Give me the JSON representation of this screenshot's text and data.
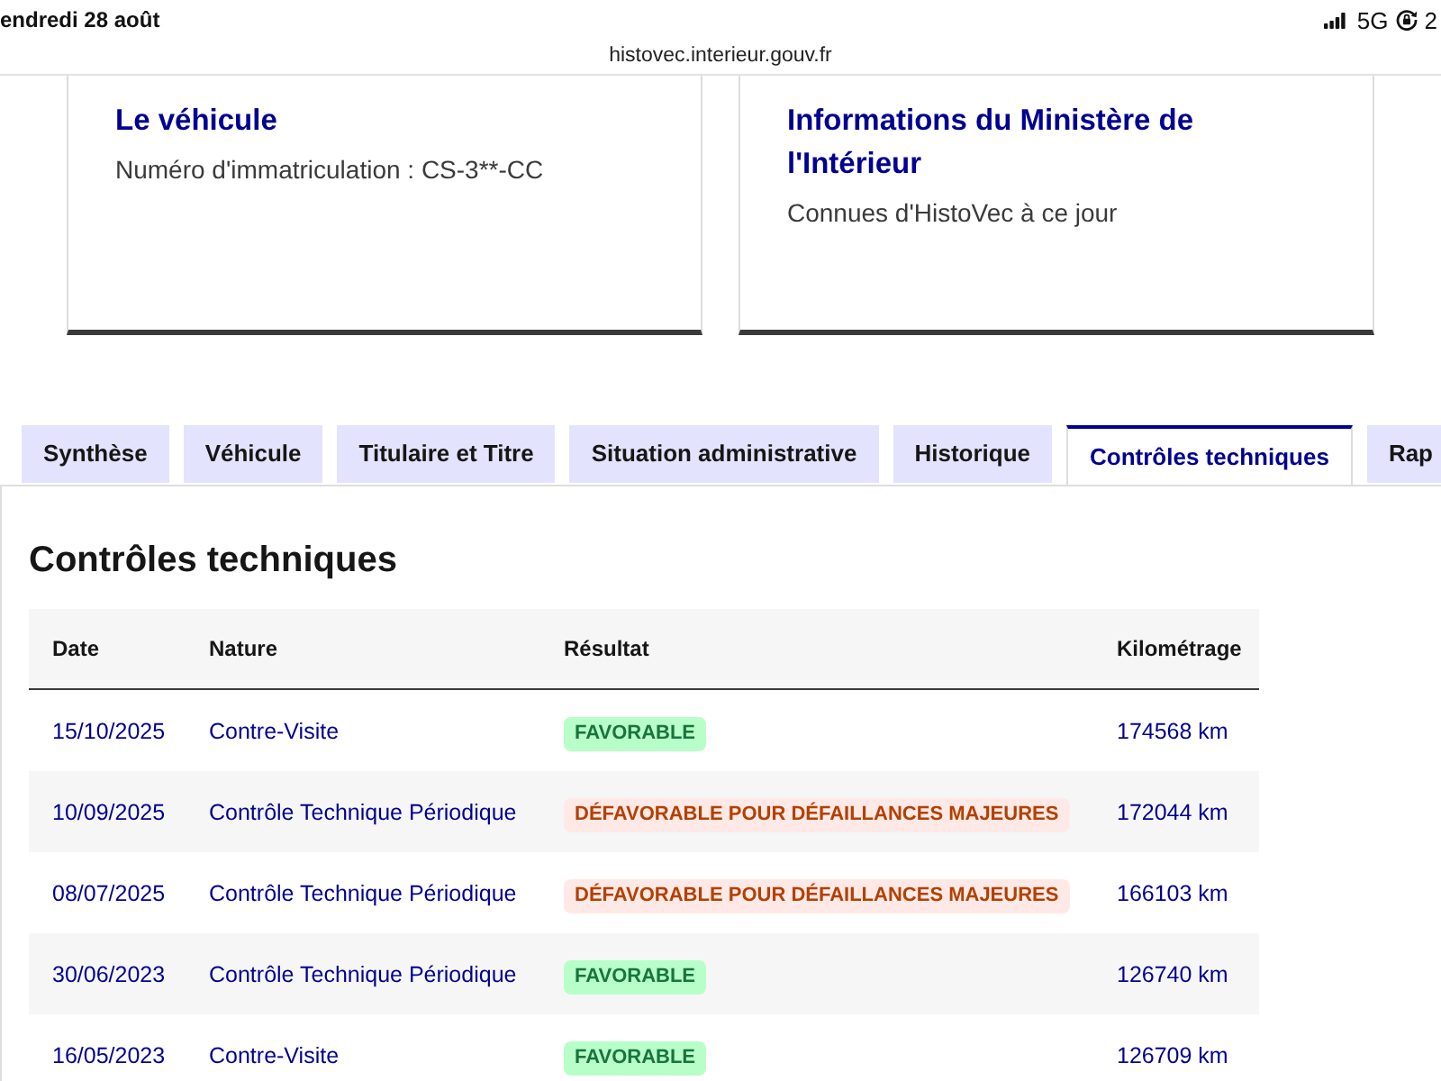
{
  "status_bar": {
    "date": "endredi 28 août",
    "network": "5G",
    "battery": "2"
  },
  "address_bar": {
    "url": "histovec.interieur.gouv.fr"
  },
  "cards": [
    {
      "title": "Le véhicule",
      "text": "Numéro d'immatriculation : CS-3**-CC"
    },
    {
      "title": "Informations du Ministère de l'Intérieur",
      "text": "Connues d'HistoVec à ce jour"
    }
  ],
  "tabs": [
    {
      "label": "Synthèse",
      "selected": false
    },
    {
      "label": "Véhicule",
      "selected": false
    },
    {
      "label": "Titulaire et Titre",
      "selected": false
    },
    {
      "label": "Situation administrative",
      "selected": false
    },
    {
      "label": "Historique",
      "selected": false
    },
    {
      "label": "Contrôles techniques",
      "selected": true
    },
    {
      "label": "Rap",
      "selected": false
    }
  ],
  "panel": {
    "title": "Contrôles techniques",
    "table": {
      "columns": [
        "Date",
        "Nature",
        "Résultat",
        "Kilométrage"
      ],
      "rows": [
        {
          "date": "15/10/2025",
          "nature": "Contre-Visite",
          "result": {
            "label": "FAVORABLE",
            "kind": "favorable"
          },
          "mileage": "174568 km"
        },
        {
          "date": "10/09/2025",
          "nature": "Contrôle Technique Périodique",
          "result": {
            "label": "DÉFAVORABLE POUR DÉFAILLANCES MAJEURES",
            "kind": "unfavorable"
          },
          "mileage": "172044 km"
        },
        {
          "date": "08/07/2025",
          "nature": "Contrôle Technique Périodique",
          "result": {
            "label": "DÉFAVORABLE POUR DÉFAILLANCES MAJEURES",
            "kind": "unfavorable"
          },
          "mileage": "166103 km"
        },
        {
          "date": "30/06/2023",
          "nature": "Contrôle Technique Périodique",
          "result": {
            "label": "FAVORABLE",
            "kind": "favorable"
          },
          "mileage": "126740 km"
        },
        {
          "date": "16/05/2023",
          "nature": "Contre-Visite",
          "result": {
            "label": "FAVORABLE",
            "kind": "favorable"
          },
          "mileage": "126709 km"
        }
      ]
    }
  }
}
